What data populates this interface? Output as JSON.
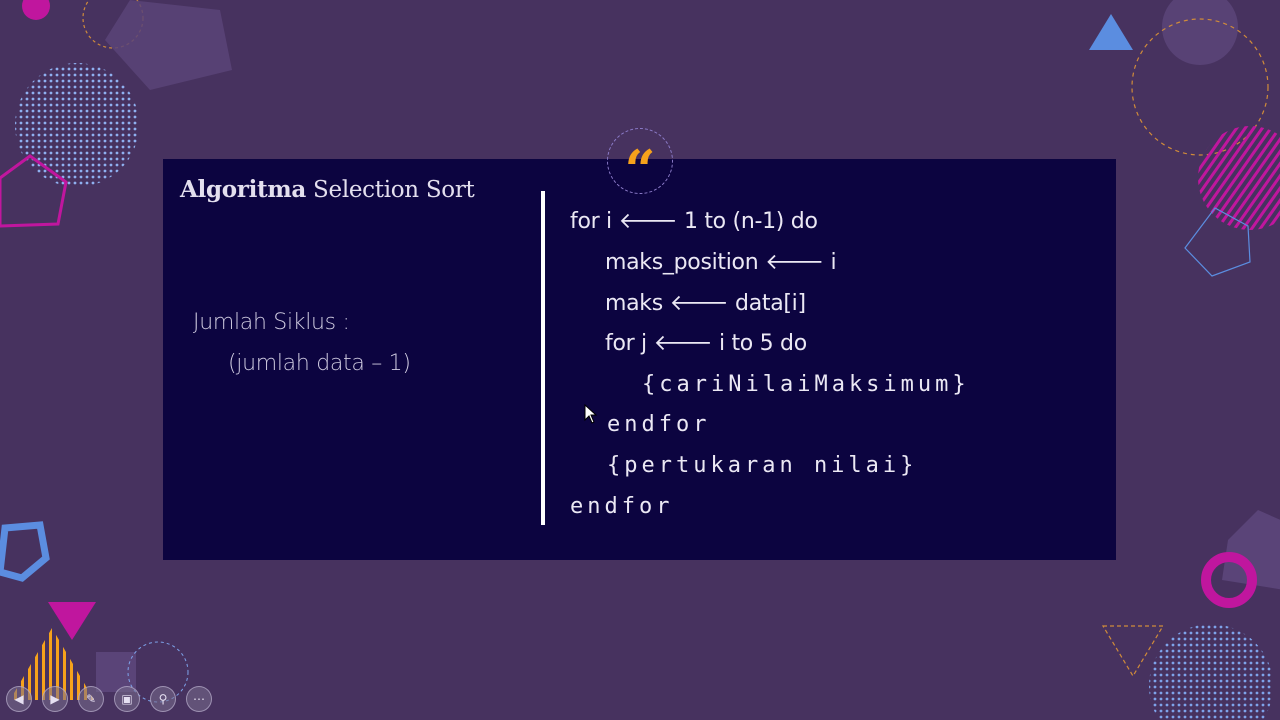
{
  "slide": {
    "title_bold": "Algoritma",
    "title_rest": "Selection Sort",
    "left": {
      "line1": "Jumlah Siklus :",
      "line2": "(jumlah data – 1)"
    },
    "code": {
      "l1_a": "for i",
      "l1_b": "1 to (n-1) do",
      "l2_a": "maks_position",
      "l2_b": "i",
      "l3_a": "maks",
      "l3_b": "data[i]",
      "l4_a": "for j",
      "l4_b": "i to 5 do",
      "l5": "{cariNilaiMaksimum}",
      "l6": "endfor",
      "l7": "{pertukaran nilai}",
      "l8": "endfor",
      "arrow": "🡐"
    },
    "quote_glyph": "“"
  },
  "nav": {
    "prev": "◀",
    "next": "▶",
    "pen": "✎",
    "slides": "▣",
    "zoom": "⚲",
    "more": "⋯"
  },
  "colors": {
    "background": "#47325f",
    "card": "#0c0440",
    "accent_orange": "#f6a21b",
    "accent_magenta": "#c0169e",
    "accent_blue": "#5b8de0"
  }
}
